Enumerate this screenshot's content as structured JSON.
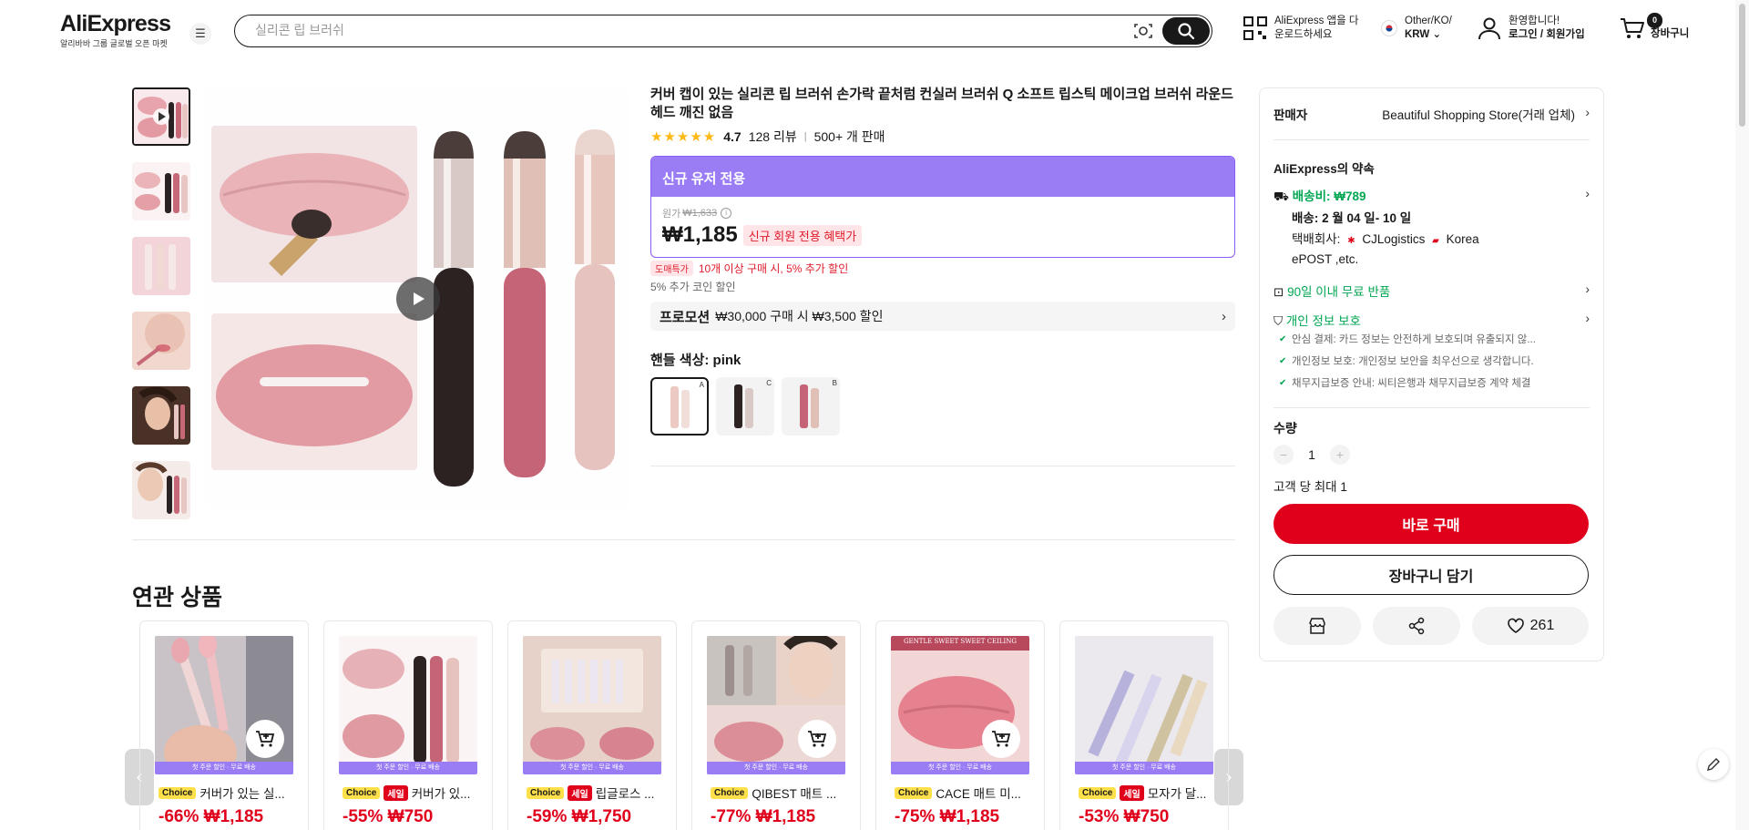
{
  "header": {
    "logo": "AliExpress",
    "logo_sub": "알리바바 그룹 글로벌 오픈 마켓",
    "search_placeholder": "실리콘 립 브러쉬",
    "app_line1": "AliExpress 앱을 다",
    "app_line2": "운로드하세요",
    "locale_line1": "Other/KO/",
    "locale_line2": "KRW",
    "welcome_line1": "환영합니다!",
    "welcome_line2": "로그인 / 회원가입",
    "cart_count": "0",
    "cart_label": "장바구니"
  },
  "product": {
    "title": "커버 캡이 있는 실리콘 립 브러쉬 손가락 끝처럼 컨실러 브러쉬 Q 소프트 립스틱 메이크업 브러쉬 라운드 헤드 깨진 없음",
    "stars": "★★★★★",
    "rating": "4.7",
    "reviews": "128 리뷰",
    "sold": "500+ 개 판매",
    "new_user_banner": "신규 유저 전용",
    "orig_label": "원가",
    "orig_price": "₩1,633",
    "price": "₩1,185",
    "price_pill": "신규 회원 전용 혜택가",
    "deal_badge": "도매특가",
    "deal_text": "10개 이상 구매 시, 5% 추가 할인",
    "coin_text": "5% 추가 코인 할인",
    "promo_tag": "프로모션",
    "promo_text": "₩30,000 구매 시 ₩3,500 할인",
    "color_label": "핸들 색상: pink",
    "swatch_marks": [
      "A",
      "C",
      "B"
    ]
  },
  "panel": {
    "seller_label": "판매자",
    "seller_name": "Beautiful Shopping Store(거래 업체)",
    "promise_title": "AliExpress의 약속",
    "shipping_fee": "배송비: ₩789",
    "delivery": "배송: 2 월 04 일- 10 일",
    "courier_label": "택배회사:",
    "courier_1": "CJLogistics",
    "courier_2": "Korea",
    "courier_3": "ePOST ,etc.",
    "returns": "90일 이내 무료 반품",
    "privacy": "개인 정보 보호",
    "privacy_items": [
      "안심 결제: 카드 정보는 안전하게 보호되며 유출되지 않...",
      "개인정보 보호: 개인정보 보안을 최우선으로 생각합니다.",
      "채무지급보증 안내: 씨티은행과 채무지급보증 계약 체결"
    ],
    "qty_label": "수량",
    "qty_value": "1",
    "qty_limit": "고객 당 최대 1",
    "buy_now": "바로 구매",
    "add_to_cart": "장바구니 담기",
    "wishlist_count": "261"
  },
  "related": {
    "title": "연관 상품",
    "band_text": "첫 주문 할인 · 무료 배송",
    "choice_label": "Choice",
    "sale_label": "세일",
    "items": [
      {
        "name": "커버가 있는 실...",
        "discount": "-66%",
        "price": "₩1,185"
      },
      {
        "name": "커버가 있...",
        "discount": "-55%",
        "price": "₩750"
      },
      {
        "name": "립글로스 ...",
        "discount": "-59%",
        "price": "₩1,750"
      },
      {
        "name": "QIBEST 매트 ...",
        "discount": "-77%",
        "price": "₩1,185"
      },
      {
        "name": "CACE 매트 미...",
        "discount": "-75%",
        "price": "₩1,185"
      },
      {
        "name": "모자가 달...",
        "discount": "-53%",
        "price": "₩750"
      }
    ],
    "item5_caption": "GENTLE SWEET SWEET CEILING"
  },
  "colors": {
    "accent_red": "#e0001b",
    "choice_yellow": "#fde04a",
    "promo_purple": "#9a7df5",
    "success_green": "#00a651"
  }
}
